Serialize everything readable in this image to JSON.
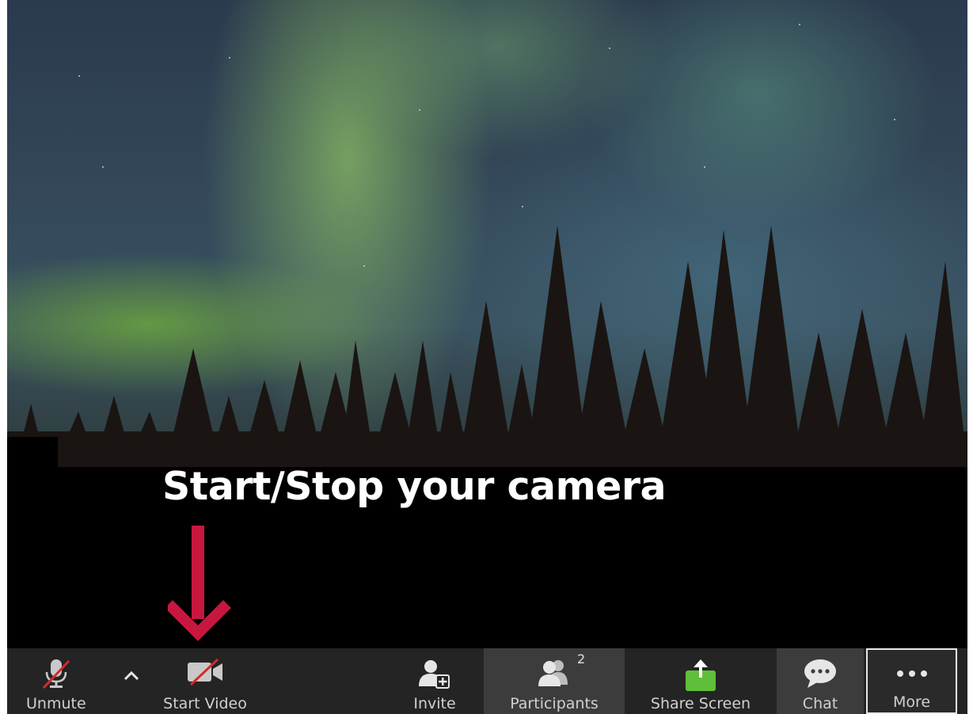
{
  "annotation": {
    "caption": "Start/Stop your camera",
    "arrow_color": "#c8173f"
  },
  "video": {
    "background": "northern-lights-forest"
  },
  "toolbar": {
    "unmute_label": "Unmute",
    "start_video_label": "Start Video",
    "invite_label": "Invite",
    "participants_label": "Participants",
    "participants_count": "2",
    "share_screen_label": "Share Screen",
    "chat_label": "Chat",
    "more_label": "More"
  },
  "colors": {
    "toolbar_bg": "#242424",
    "share_green": "#5fbf3a",
    "muted_red": "#d22b2b"
  }
}
